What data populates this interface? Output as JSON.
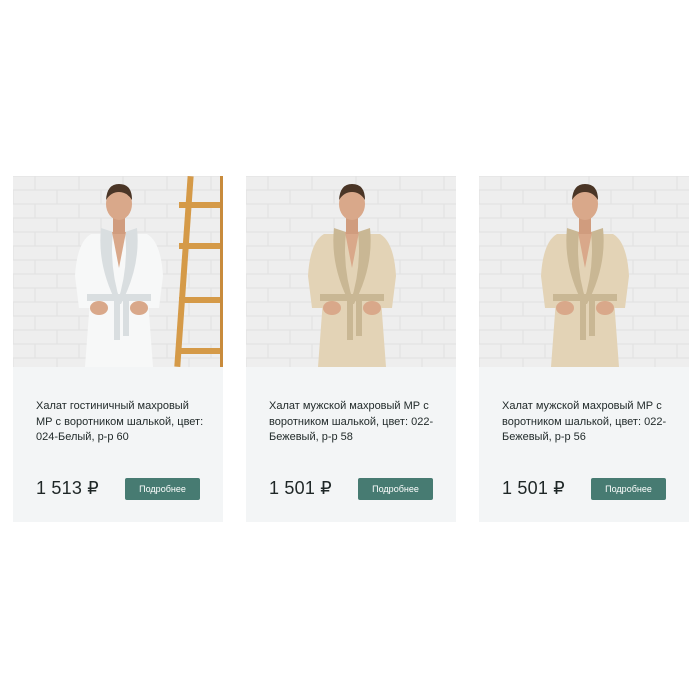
{
  "products": [
    {
      "title": "Халат гостиничный махровый МР с воротником шалькой, цвет: 024-Белый, р-р 60",
      "price": "1 513 ₽",
      "button_label": "Подробнее",
      "robe_color": "#f7f8f8",
      "robe_shade": "#d9dee0",
      "has_ladder": true
    },
    {
      "title": "Халат мужской махровый МР с воротником шалькой, цвет: 022-Бежевый, р-р 58",
      "price": "1 501 ₽",
      "button_label": "Подробнее",
      "robe_color": "#e3d3b6",
      "robe_shade": "#c9b794",
      "has_ladder": false
    },
    {
      "title": "Халат мужской махровый МР с воротником шалькой, цвет: 022-Бежевый, р-р 56",
      "price": "1 501 ₽",
      "button_label": "Подробнее",
      "robe_color": "#e3d3b6",
      "robe_shade": "#c9b794",
      "has_ladder": false
    }
  ],
  "colors": {
    "button_bg": "#477b72",
    "card_bg": "#f3f5f6",
    "wall": "#eeeeee"
  }
}
